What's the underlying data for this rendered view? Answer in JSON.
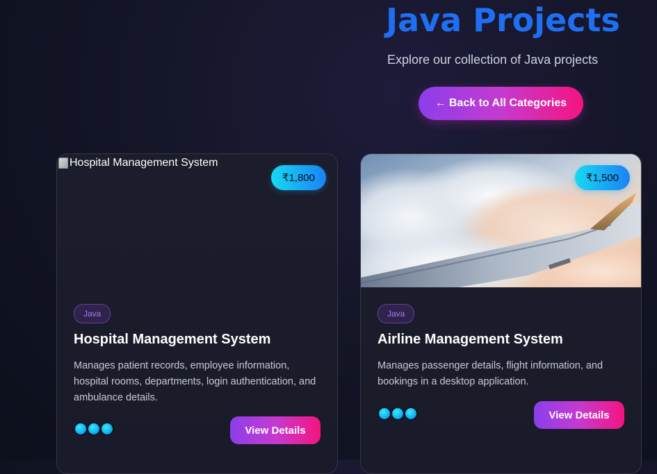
{
  "header": {
    "title": "Java Projects",
    "subtitle": "Explore our collection of Java projects",
    "back_button": {
      "arrow": "←",
      "label": "Back to All Categories"
    }
  },
  "projects": [
    {
      "title": "Hospital Management System",
      "image_alt": "Hospital Management System",
      "image_state": "broken",
      "price": "₹1,800",
      "tag": "Java",
      "description": "Manages patient records, employee information, hospital rooms, departments, login authentication, and ambulance details.",
      "button_label": "View Details"
    },
    {
      "title": "Airline Management System",
      "image_alt": "Airline Management System",
      "image_state": "airplane-wing-over-clouds",
      "price": "₹1,500",
      "tag": "Java",
      "description": "Manages passenger details, flight information, and bookings in a desktop application.",
      "button_label": "View Details"
    }
  ],
  "colors": {
    "title": "#1f6ff2",
    "price_badge": [
      "#17d9f2",
      "#1a82f5"
    ],
    "button_gradient": [
      "#8b3fea",
      "#c53ad0",
      "#f5147f"
    ],
    "tag": "#a87cf0"
  }
}
